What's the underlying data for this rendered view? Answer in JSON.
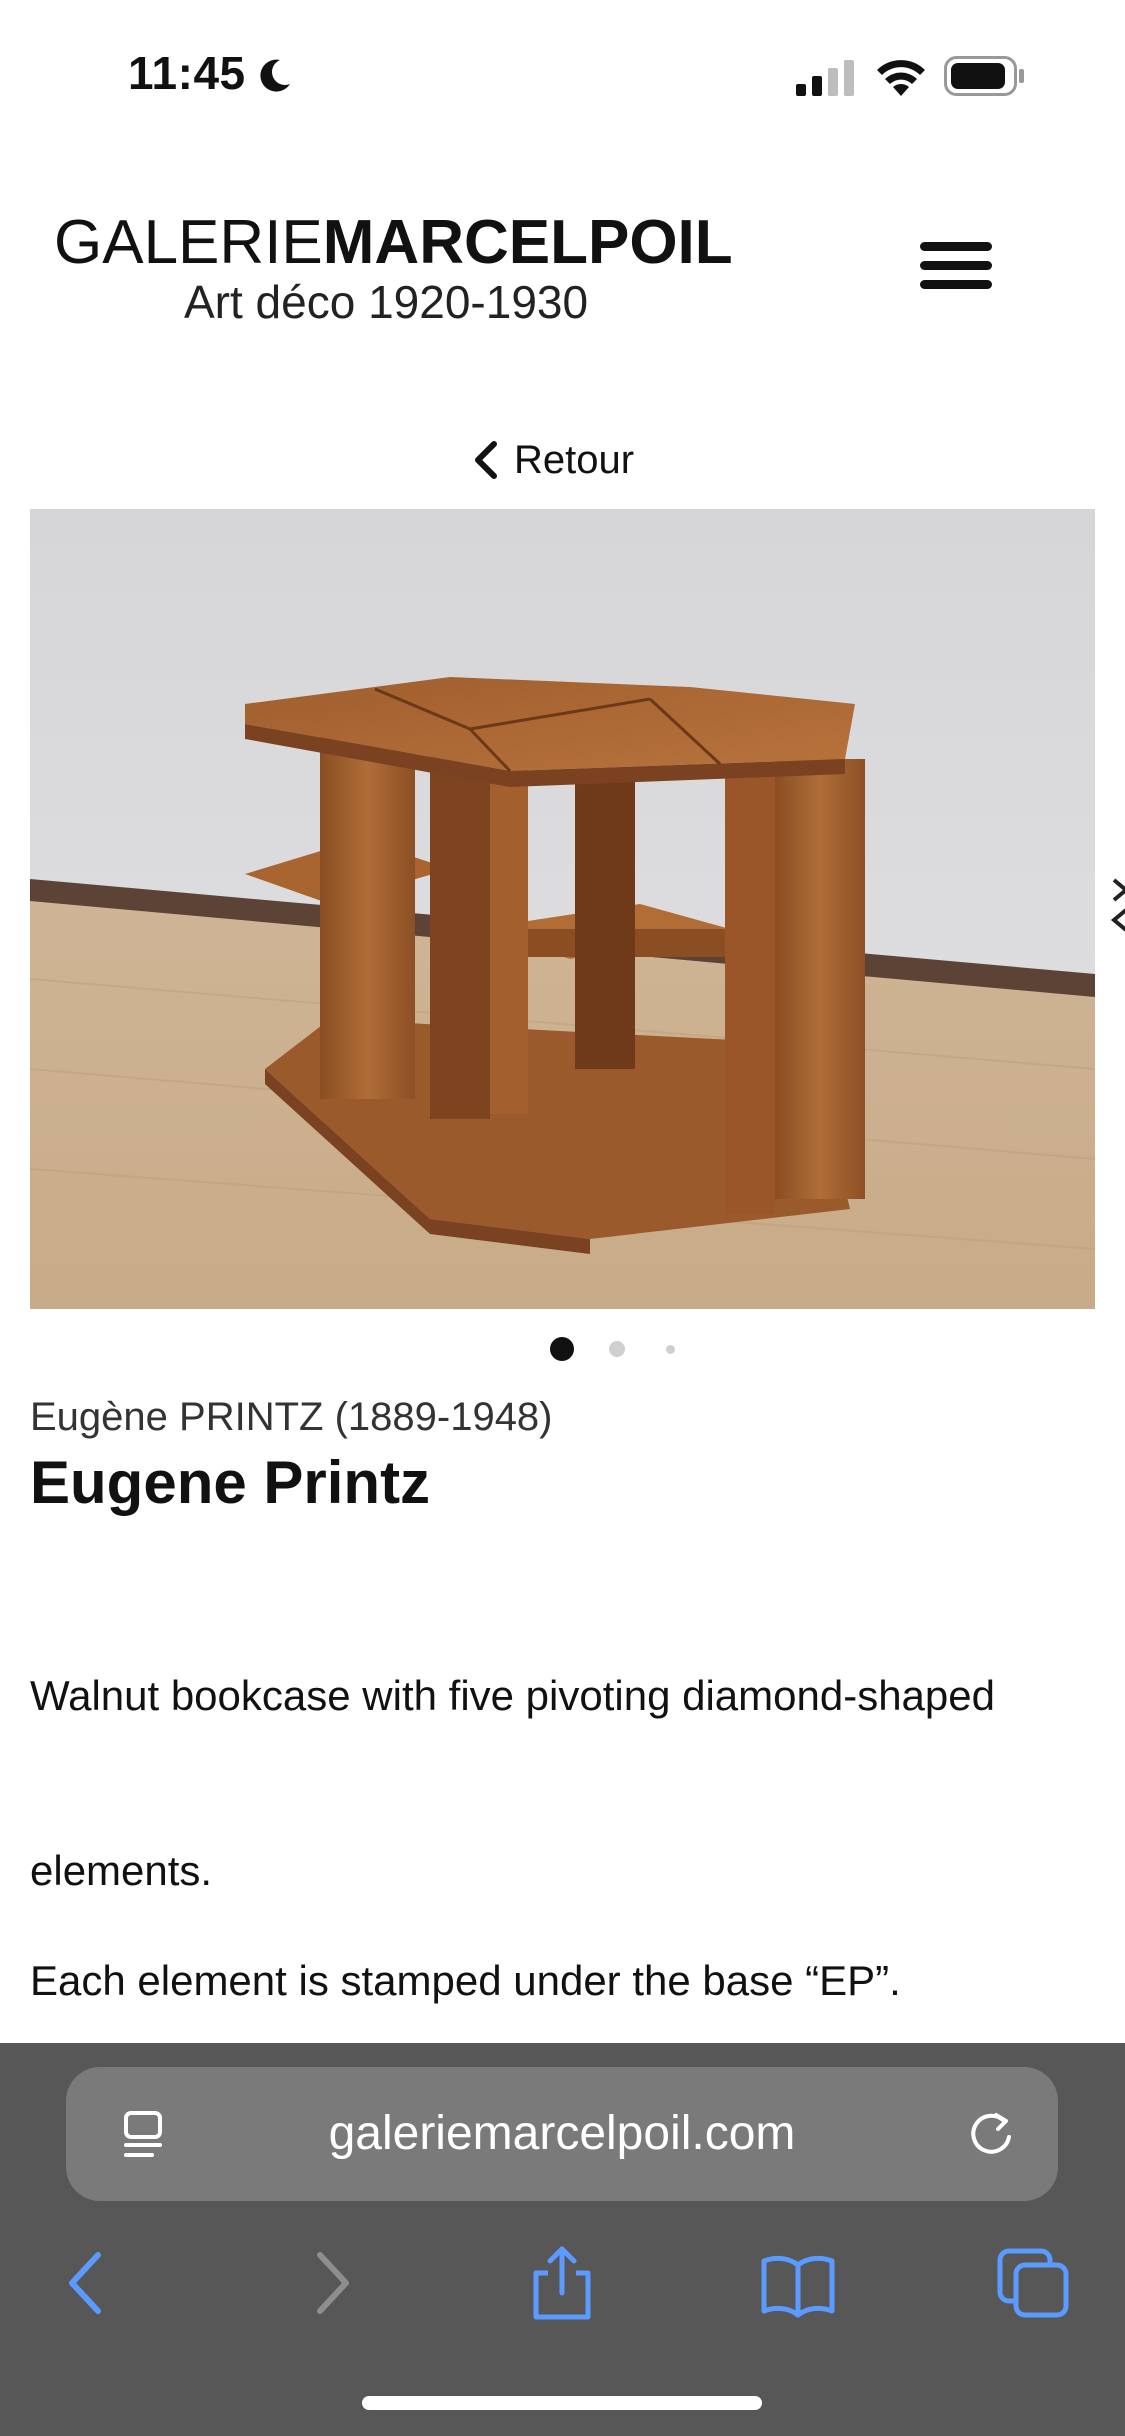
{
  "status_bar": {
    "time": "11:45",
    "icons": [
      "moon-icon",
      "cellular-signal-icon",
      "wifi-icon",
      "battery-icon"
    ]
  },
  "header": {
    "brand_light": "GALERIE",
    "brand_bold": "MARCELPOIL",
    "tagline": "Art déco 1920-1930",
    "menu_icon": "hamburger-menu-icon"
  },
  "nav": {
    "back_label": "Retour",
    "back_icon": "chevron-left-icon"
  },
  "carousel": {
    "slide_count": 3,
    "active_index": 0,
    "next_icon": "chevron-right-icon"
  },
  "product": {
    "designer": "Eugène PRINTZ (1889-1948)",
    "title": "Eugene Printz",
    "description_1": "Walnut bookcase with five pivoting diamond-shaped",
    "description_2": "elements.",
    "description_3": "Each element is stamped under the base “EP”."
  },
  "browser": {
    "url": "galeriemarcelpoil.com",
    "icons": [
      "reader-mode-icon",
      "reload-icon",
      "back-icon",
      "forward-icon",
      "share-icon",
      "bookmarks-icon",
      "tabs-icon"
    ],
    "accent": "#5b9bff",
    "bar_color": "#575757"
  }
}
